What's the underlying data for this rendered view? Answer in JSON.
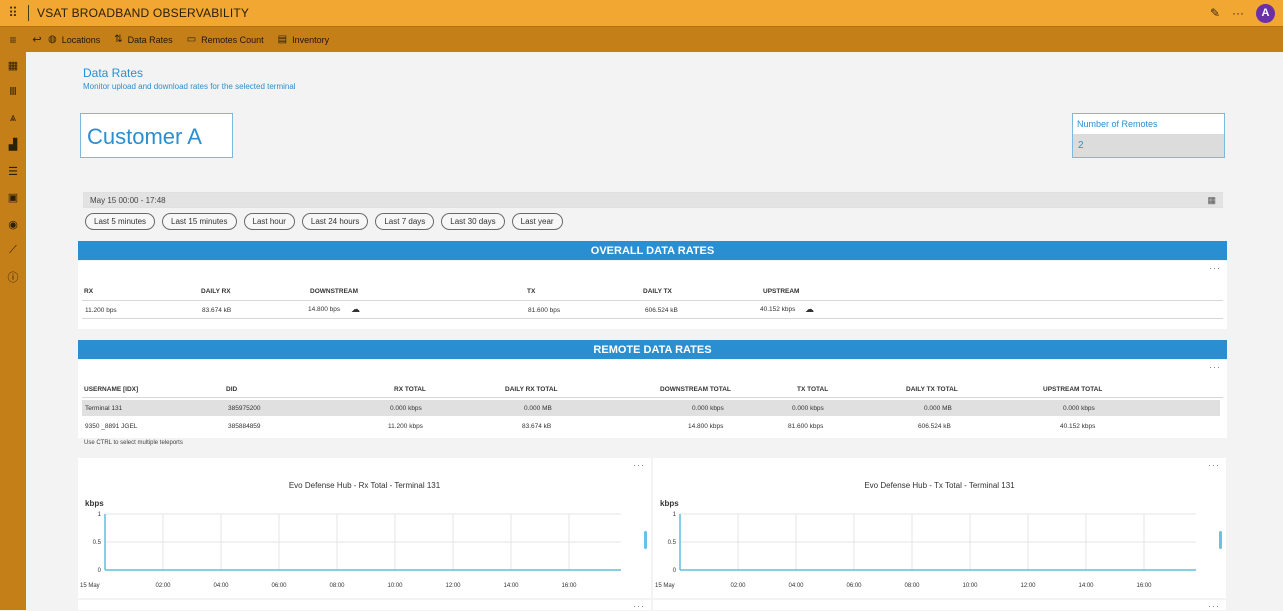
{
  "app": {
    "title": "VSAT BROADBAND OBSERVABILITY",
    "user_initial": "A"
  },
  "nav": {
    "items": [
      "Locations",
      "Data Rates",
      "Remotes Count",
      "Inventory"
    ]
  },
  "page": {
    "title": "Data Rates",
    "subtitle": "Monitor upload and download rates for the selected terminal"
  },
  "customer": "Customer A",
  "remotes": {
    "label": "Number of Remotes",
    "value": "2"
  },
  "date_range": "May 15 00:00 - 17:48",
  "time_ranges": [
    "Last 5 minutes",
    "Last 15 minutes",
    "Last hour",
    "Last 24 hours",
    "Last 7 days",
    "Last 30 days",
    "Last year"
  ],
  "overall": {
    "title": "OVERALL DATA RATES",
    "headers": [
      "RX",
      "DAILY RX",
      "DOWNSTREAM",
      "TX",
      "DAILY TX",
      "UPSTREAM"
    ],
    "row": [
      "11.200 bps",
      "83.674 kB",
      "14.800 bps",
      "81.600 bps",
      "606.524 kB",
      "40.152 kbps"
    ]
  },
  "remote": {
    "title": "REMOTE DATA RATES",
    "headers": [
      "USERNAME [IDX]",
      "DID",
      "RX TOTAL",
      "DAILY RX TOTAL",
      "DOWNSTREAM TOTAL",
      "TX TOTAL",
      "DAILY TX TOTAL",
      "UPSTREAM TOTAL"
    ],
    "rows": [
      [
        "Terminal 131",
        "385975200",
        "0.000 kbps",
        "0.000 MB",
        "0.000 kbps",
        "0.000 kbps",
        "0.000 MB",
        "0.000 kbps"
      ],
      [
        "9350 _8891 JGEL",
        "385884859",
        "11.200 kbps",
        "83.674 kB",
        "14.800 kbps",
        "81.600 kbps",
        "606.524 kB",
        "40.152 kbps"
      ]
    ],
    "hint": "Use CTRL to select multiple teleports"
  },
  "charts": [
    {
      "title": "Evo Defense Hub - Rx Total - Terminal 131",
      "unit": "kbps"
    },
    {
      "title": "Evo Defense Hub - Tx Total - Terminal 131",
      "unit": "kbps"
    }
  ],
  "chart_data": [
    {
      "type": "line",
      "title": "Evo Defense Hub - Rx Total - Terminal 131",
      "ylabel": "kbps",
      "ylim": [
        0,
        1
      ],
      "yticks": [
        "0",
        "0.5",
        "1"
      ],
      "xticks": [
        "15 May",
        "02:00",
        "04:00",
        "06:00",
        "08:00",
        "10:00",
        "12:00",
        "14:00",
        "16:00"
      ],
      "series": [
        {
          "values": [
            0,
            0,
            0,
            0,
            0,
            0,
            0,
            0,
            0
          ]
        }
      ],
      "grid": true,
      "color": "#5bc0de"
    },
    {
      "type": "line",
      "title": "Evo Defense Hub - Tx Total - Terminal 131",
      "ylabel": "kbps",
      "ylim": [
        0,
        1
      ],
      "yticks": [
        "0",
        "0.5",
        "1"
      ],
      "xticks": [
        "15 May",
        "02:00",
        "04:00",
        "06:00",
        "08:00",
        "10:00",
        "12:00",
        "14:00",
        "16:00"
      ],
      "series": [
        {
          "values": [
            0,
            0,
            0,
            0,
            0,
            0,
            0,
            0,
            0
          ]
        }
      ],
      "grid": true,
      "color": "#5bc0de"
    }
  ]
}
